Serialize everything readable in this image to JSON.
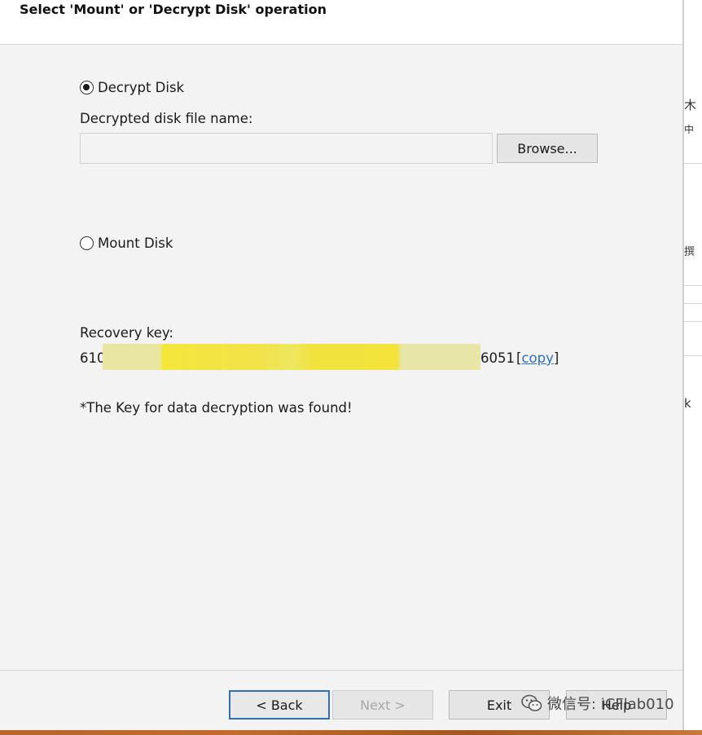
{
  "header": {
    "title": "Select 'Mount' or 'Decrypt Disk' operation"
  },
  "options": {
    "decrypt": {
      "label": "Decrypt Disk",
      "checked": true
    },
    "mount": {
      "label": "Mount Disk",
      "checked": false
    }
  },
  "decrypt_file": {
    "label": "Decrypted disk file name:",
    "value": "",
    "browse_label": "Browse..."
  },
  "recovery": {
    "label": "Recovery key:",
    "prefix": "610",
    "suffix": "6051",
    "copy_open": "[",
    "copy_label": "copy",
    "copy_close": "]"
  },
  "status_message": "*The Key for data decryption was found!",
  "footer": {
    "back_label": "< Back",
    "next_label": "Next >",
    "exit_label": "Exit",
    "help_label": "Help"
  },
  "watermark": {
    "text": "微信号: iCFlab010"
  },
  "background_window": {
    "glyphs": [
      "木",
      "中",
      "撰",
      "k"
    ]
  },
  "colors": {
    "accent": "#2f6fbf",
    "redaction": "#f5e63a"
  }
}
